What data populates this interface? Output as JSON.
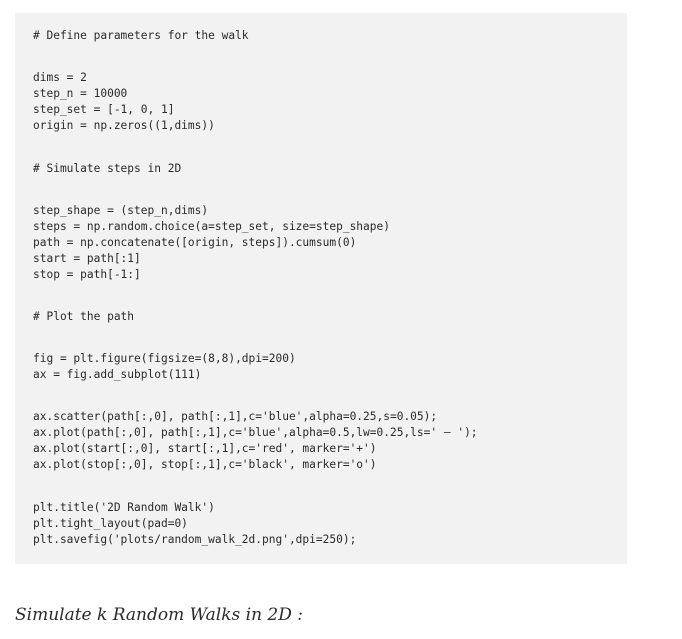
{
  "code": {
    "lines": [
      "# Define parameters for the walk",
      "dims = 2",
      "step_n = 10000",
      "step_set = [-1, 0, 1]",
      "origin = np.zeros((1,dims))",
      "# Simulate steps in 2D",
      "step_shape = (step_n,dims)",
      "steps = np.random.choice(a=step_set, size=step_shape)",
      "path = np.concatenate([origin, steps]).cumsum(0)",
      "start = path[:1]",
      "stop = path[-1:]",
      "# Plot the path",
      "fig = plt.figure(figsize=(8,8),dpi=200)",
      "ax = fig.add_subplot(111)",
      "ax.scatter(path[:,0], path[:,1],c='blue',alpha=0.25,s=0.05);",
      "ax.plot(path[:,0], path[:,1],c='blue',alpha=0.5,lw=0.25,ls=' — ');",
      "ax.plot(start[:,0], start[:,1],c='red', marker='+')",
      "ax.plot(stop[:,0], stop[:,1],c='black', marker='o')",
      "plt.title('2D Random Walk')",
      "plt.tight_layout(pad=0)",
      "plt.savefig('plots/random_walk_2d.png',dpi=250);"
    ]
  },
  "caption": "Simulate k Random Walks in 2D :"
}
